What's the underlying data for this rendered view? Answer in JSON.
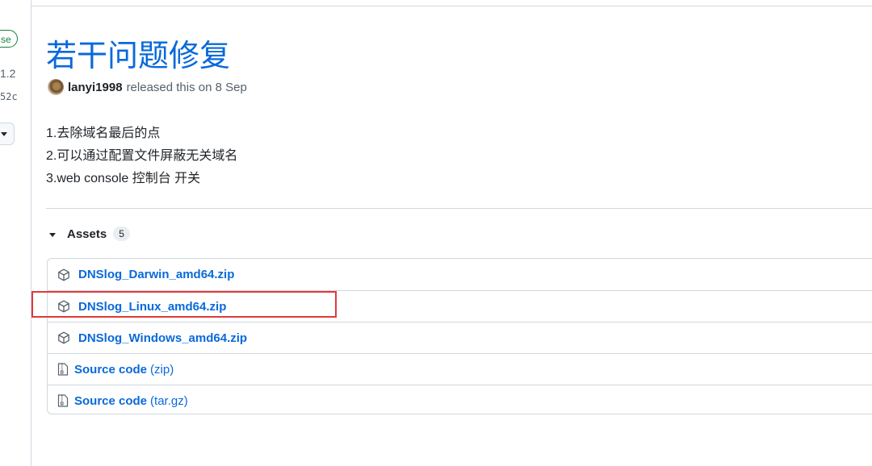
{
  "sidebar": {
    "badge_label": "se",
    "tag_fragment": "1.2",
    "commit_fragment": "52c"
  },
  "release": {
    "title": "若干问题修复",
    "author": "lanyi1998",
    "released_text": "released this on 8 Sep",
    "notes": [
      "1.去除域名最后的点",
      "2.可以通过配置文件屏蔽无关域名",
      "3.web console 控制台 开关"
    ]
  },
  "assets": {
    "label": "Assets",
    "count": "5",
    "items": [
      {
        "name": "DNSlog_Darwin_amd64.zip",
        "icon": "package-icon"
      },
      {
        "name": "DNSlog_Linux_amd64.zip",
        "icon": "package-icon"
      },
      {
        "name": "DNSlog_Windows_amd64.zip",
        "icon": "package-icon"
      },
      {
        "name": "Source code",
        "suffix": "(zip)",
        "icon": "file-zip-icon"
      },
      {
        "name": "Source code",
        "suffix": "(tar.gz)",
        "icon": "file-zip-icon"
      }
    ]
  },
  "colors": {
    "link": "#0969da",
    "highlight": "#e03a3a",
    "latest_badge": "#1a7f37"
  }
}
